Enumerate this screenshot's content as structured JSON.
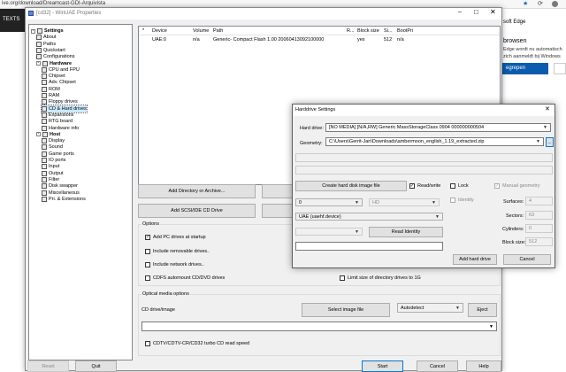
{
  "browser": {
    "url": "ive.org/download/Dreamcast-GDI-Arquivista",
    "left_label": "TEXTS",
    "right_text_1": "soft Edge",
    "right_text_2": "browsen",
    "right_text_3": "Edge wordt nu automatisch",
    "right_text_4": "zich aanmeldt bij Windows",
    "right_button": "egrepen"
  },
  "winuae": {
    "title": "[cd32] - WinUAE Properties",
    "tree": [
      {
        "label": "Settings",
        "level": 0,
        "bold": true,
        "icon": "folder-icon"
      },
      {
        "label": "About",
        "level": 1,
        "icon": "about-icon"
      },
      {
        "label": "Paths",
        "level": 1,
        "icon": "paths-icon"
      },
      {
        "label": "Quickstart",
        "level": 1,
        "icon": "quickstart-icon"
      },
      {
        "label": "Configurations",
        "level": 1,
        "icon": "configurations-icon"
      },
      {
        "label": "Hardware",
        "level": 1,
        "bold": true,
        "icon": "folder-icon"
      },
      {
        "label": "CPU and FPU",
        "level": 2,
        "icon": "cpu-icon"
      },
      {
        "label": "Chipset",
        "level": 2,
        "icon": "chipset-icon"
      },
      {
        "label": "Adv. Chipset",
        "level": 2,
        "icon": "adv-chipset-icon"
      },
      {
        "label": "ROM",
        "level": 2,
        "icon": "rom-icon"
      },
      {
        "label": "RAM",
        "level": 2,
        "icon": "ram-icon"
      },
      {
        "label": "Floppy drives",
        "level": 2,
        "icon": "floppy-icon"
      },
      {
        "label": "CD & Hard drives",
        "level": 2,
        "icon": "cd-hard-drive-icon",
        "selected": true
      },
      {
        "label": "Expansions",
        "level": 2,
        "icon": "expansions-icon"
      },
      {
        "label": "RTG board",
        "level": 2,
        "icon": "rtg-board-icon"
      },
      {
        "label": "Hardware info",
        "level": 2,
        "icon": "hardware-info-icon"
      },
      {
        "label": "Host",
        "level": 1,
        "bold": true,
        "icon": "folder-icon"
      },
      {
        "label": "Display",
        "level": 2,
        "icon": "display-icon"
      },
      {
        "label": "Sound",
        "level": 2,
        "icon": "sound-icon"
      },
      {
        "label": "Game ports",
        "level": 2,
        "icon": "game-ports-icon"
      },
      {
        "label": "IO ports",
        "level": 2,
        "icon": "io-ports-icon"
      },
      {
        "label": "Input",
        "level": 2,
        "icon": "input-icon"
      },
      {
        "label": "Output",
        "level": 2,
        "icon": "output-icon"
      },
      {
        "label": "Filter",
        "level": 2,
        "icon": "filter-icon"
      },
      {
        "label": "Disk swapper",
        "level": 2,
        "icon": "disk-swapper-icon"
      },
      {
        "label": "Miscellaneous",
        "level": 2,
        "icon": "miscellaneous-icon"
      },
      {
        "label": "Pri. & Extensions",
        "level": 2,
        "icon": "extensions-icon"
      }
    ],
    "table": {
      "headers": [
        "*",
        "Device",
        "Volume",
        "Path",
        "R...",
        "Block size",
        "Si...",
        "BootPri"
      ],
      "rows": [
        [
          "",
          "UAE:0",
          "n/a",
          "Generic- Compact Flash 1.00 20060413092100000",
          "",
          "yes",
          "512",
          "n/a"
        ]
      ]
    },
    "buttons": {
      "add_directory": "Add Directory or Archive...",
      "add_scsi": "Add SCSI/IDE CD Drive",
      "select_image": "Select image file",
      "eject": "Eject",
      "reset": "Reset",
      "quit": "Quit",
      "start": "Start",
      "cancel": "Cancel",
      "help": "Help"
    },
    "options_label": "Options",
    "options": {
      "add_pc_drives": {
        "label": "Add PC drives at startup",
        "checked": true
      },
      "include_removable": {
        "label": "Include removable drives..",
        "checked": false
      },
      "include_network": {
        "label": "Include network drives..",
        "checked": false
      },
      "cdfs_automount": {
        "label": "CDFS automount CD/DVD drives",
        "checked": false
      },
      "limit_size": {
        "label": "Limit size of directory drives to 1G",
        "checked": false
      }
    },
    "optical_label": "Optical media options",
    "cd_drive_label": "CD drive/image",
    "autodetect_value": "Autodetect",
    "cdtv_label": "CDTV/CDTV-CR/CD32 turbo CD read speed"
  },
  "harddrive": {
    "title": "Harddrive Settings",
    "hard_drive_label": "Hard drive:",
    "hard_drive_value": "[NO MEDIA] [N/A,RW] Generic MassStorageClass 0904 000000000504",
    "geometry_label": "Geometry:",
    "geometry_value": "C:\\Users\\Gerrit-Jan\\Downloads\\ambermoon_english_1.19_extracted.zip",
    "browse_button": "...",
    "create_button": "Create hard disk image file",
    "read_write": {
      "label": "Read/write",
      "checked": true
    },
    "lock": {
      "label": "Lock",
      "checked": false
    },
    "manual_geometry": {
      "label": "Manual geometry",
      "checked": true
    },
    "identity": {
      "label": "Identity",
      "checked": false
    },
    "controller_num": "0",
    "controller_type": "HD",
    "device_name": "UAE (uaehf.device)",
    "read_identity_button": "Read Identity",
    "surfaces_label": "Surfaces:",
    "surfaces_value": "4",
    "sectors_label": "Sectors:",
    "sectors_value": "63",
    "cylinders_label": "Cylinders:",
    "cylinders_value": "0",
    "block_size_label": "Block size:",
    "block_size_value": "512",
    "add_button": "Add hard drive",
    "cancel_button": "Cancel"
  }
}
